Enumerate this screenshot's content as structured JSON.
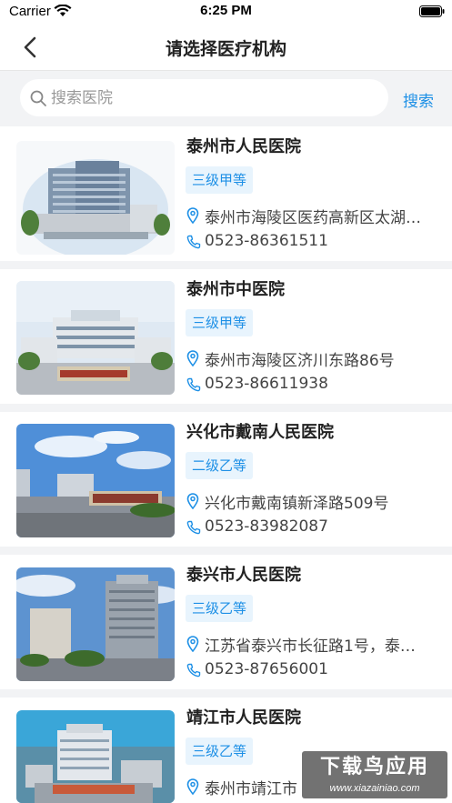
{
  "status_bar": {
    "carrier": "Carrier",
    "time": "6:25 PM"
  },
  "nav": {
    "title": "请选择医疗机构",
    "back_icon": "chevron-left-icon"
  },
  "search": {
    "placeholder": "搜索医院",
    "value": "",
    "button_label": "搜索",
    "icon": "search-icon"
  },
  "colors": {
    "accent": "#1e90e6",
    "badge_bg": "#e8f4fd",
    "page_bg": "#f2f3f5"
  },
  "hospitals": [
    {
      "name": "泰州市人民医院",
      "level": "三级甲等",
      "address": "泰州市海陵区医药高新区太湖…",
      "phone": "0523-86361511"
    },
    {
      "name": "泰州市中医院",
      "level": "三级甲等",
      "address": "泰州市海陵区济川东路86号",
      "phone": "0523-86611938"
    },
    {
      "name": "兴化市戴南人民医院",
      "level": "二级乙等",
      "address": "兴化市戴南镇新泽路509号",
      "phone": "0523-83982087"
    },
    {
      "name": "泰兴市人民医院",
      "level": "三级乙等",
      "address": "江苏省泰兴市长征路1号，泰…",
      "phone": "0523-87656001"
    },
    {
      "name": "靖江市人民医院",
      "level": "三级乙等",
      "address": "泰州市靖江市",
      "phone": ""
    }
  ],
  "watermark": {
    "title": "下载鸟应用",
    "url": "www.xiazainiao.com"
  }
}
